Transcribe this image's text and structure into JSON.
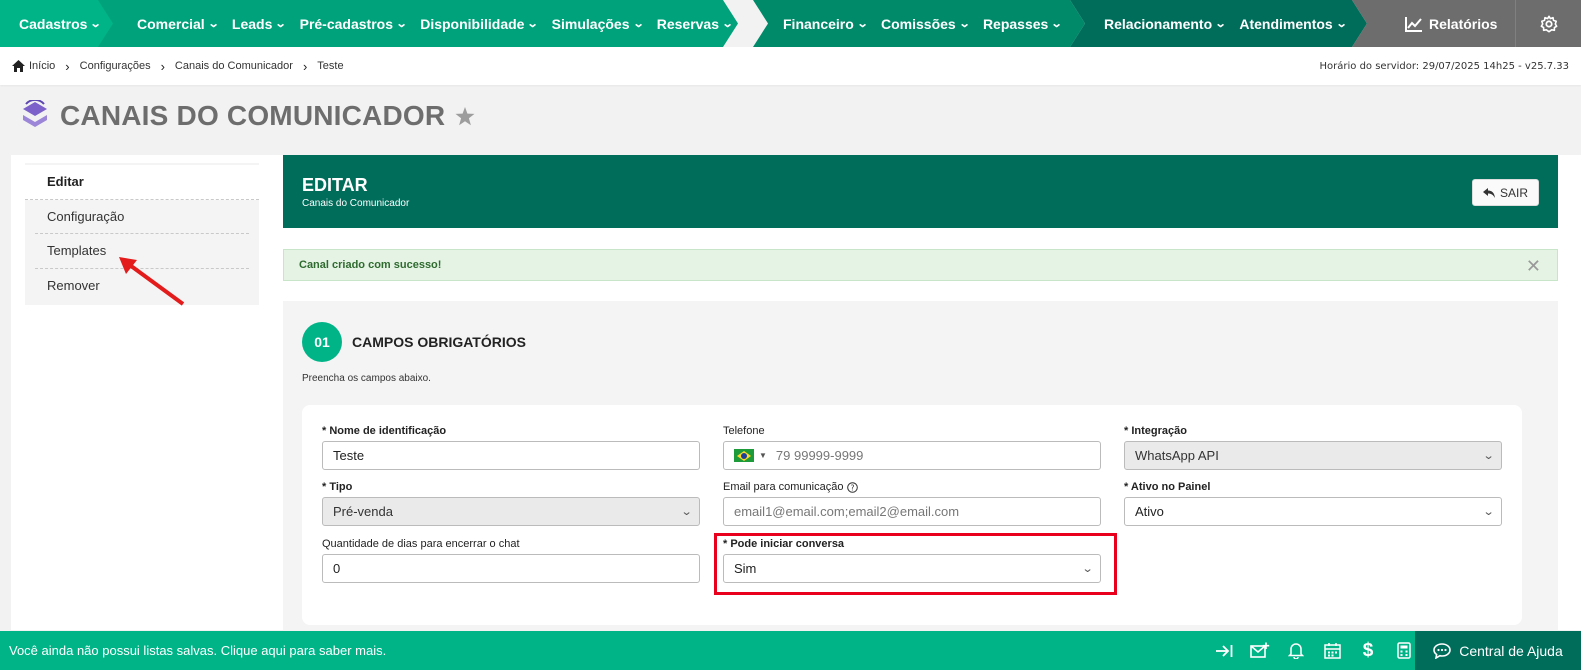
{
  "nav": {
    "cadastros": "Cadastros",
    "comercial": "Comercial",
    "leads": "Leads",
    "pre_cadastros": "Pré-cadastros",
    "disponibilidade": "Disponibilidade",
    "simulacoes": "Simulações",
    "reservas": "Reservas",
    "financeiro": "Financeiro",
    "comissoes": "Comissões",
    "repasses": "Repasses",
    "relacionamento": "Relacionamento",
    "atendimentos": "Atendimentos",
    "relatorios": "Relatórios",
    "colors": {
      "seg1": "#00b488",
      "seg2": "#00a27c",
      "seg3": "#008a6a",
      "seg4": "#006d5b",
      "seg5": "#6d6d6d"
    }
  },
  "breadcrumb": {
    "items": [
      "Início",
      "Configurações",
      "Canais do Comunicador",
      "Teste"
    ],
    "server_time": "Horário do servidor: 29/07/2025 14h25 - v25.7.33"
  },
  "page": {
    "title": "CANAIS DO COMUNICADOR"
  },
  "sidebar": {
    "items": [
      {
        "label": "Editar",
        "active": true
      },
      {
        "label": "Configuração"
      },
      {
        "label": "Templates"
      },
      {
        "label": "Remover"
      }
    ]
  },
  "header": {
    "title": "EDITAR",
    "subtitle": "Canais do Comunicador",
    "exit_label": "SAIR"
  },
  "alert": {
    "message": "Canal criado com sucesso!"
  },
  "section": {
    "number": "01",
    "title": "CAMPOS OBRIGATÓRIOS",
    "hint": "Preencha os campos abaixo."
  },
  "form": {
    "nome": {
      "label": "* Nome de identificação",
      "value": "Teste"
    },
    "telefone": {
      "label": "Telefone",
      "placeholder": "79 99999-9999"
    },
    "integracao": {
      "label": "* Integração",
      "value": "WhatsApp API"
    },
    "tipo": {
      "label": "* Tipo",
      "value": "Pré-venda"
    },
    "email": {
      "label": "Email para comunicação",
      "placeholder": "email1@email.com;email2@email.com"
    },
    "ativo": {
      "label": "* Ativo no Painel",
      "value": "Ativo"
    },
    "dias": {
      "label": "Quantidade de dias para encerrar o chat",
      "value": "0"
    },
    "iniciar": {
      "label": "* Pode iniciar conversa",
      "value": "Sim"
    }
  },
  "footer": {
    "message": "Você ainda não possui listas salvas. Clique aqui para saber mais.",
    "help": "Central de Ajuda"
  }
}
